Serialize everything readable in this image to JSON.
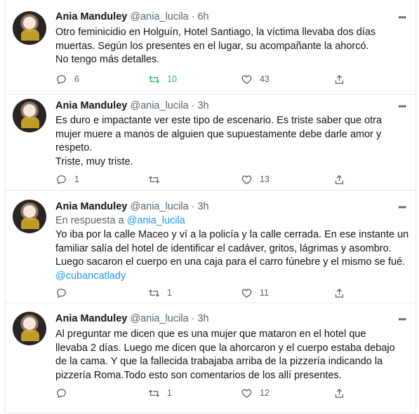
{
  "tweets": [
    {
      "name": "Ania Manduley",
      "handle": "@ania_lucila",
      "time": "· 6h",
      "reply_prefix": "",
      "reply_to": "",
      "lines": [
        "Otro feminicidio en Holguín, Hotel Santiago, la víctima llevaba dos días",
        "muertas. Según los presentes en el lugar, su acompañante la ahorcó.",
        "No tengo más detalles."
      ],
      "mention": "",
      "reply_count": "6",
      "retweet_count": "10",
      "retweet_active": true,
      "like_count": "43"
    },
    {
      "name": "Ania Manduley",
      "handle": "@ania_lucila",
      "time": "· 3h",
      "reply_prefix": "",
      "reply_to": "",
      "lines": [
        "Es duro e impactante ver este tipo de escenario. Es triste saber que otra",
        "mujer muere a manos de alguien que supuestamente debe darle amor y",
        "respeto.",
        "Triste, muy triste."
      ],
      "mention": "",
      "reply_count": "1",
      "retweet_count": "",
      "retweet_active": false,
      "like_count": "13"
    },
    {
      "name": "Ania Manduley",
      "handle": "@ania_lucila",
      "time": "· 3h",
      "reply_prefix": "En respuesta a",
      "reply_to": "@ania_lucila",
      "lines": [
        "Yo iba por la calle Maceo y ví a la policía y la calle cerrada. En ese instante un",
        "familiar salía del hotel de identificar el cadáver, gritos, lágrimas y asombro.",
        "Luego sacaron el cuerpo en una caja para el carro fúnebre y el mismo se fué."
      ],
      "mention": "@cubancatlady",
      "reply_count": "",
      "retweet_count": "1",
      "retweet_active": false,
      "like_count": "11"
    },
    {
      "name": "Ania Manduley",
      "handle": "@ania_lucila",
      "time": "· 3h",
      "reply_prefix": "",
      "reply_to": "",
      "lines": [
        "Al preguntar me dicen que es una mujer que mataron en el hotel que",
        "llevaba 2 días. Luego me dicen que la ahorcaron y el cuerpo estaba debajo",
        "de la cama. Y que la fallecida trabajaba arriba de la pizzería indicando la",
        "pizzería Roma.Todo esto son comentarios de los allí presentes."
      ],
      "mention": "",
      "reply_count": "",
      "retweet_count": "1",
      "retweet_active": false,
      "like_count": "12"
    }
  ],
  "icons": {
    "reply": "reply-icon",
    "retweet": "retweet-icon",
    "like": "heart-icon",
    "share": "share-icon",
    "more": "more-options-icon"
  },
  "colors": {
    "text": "#0f1419",
    "secondary": "#536471",
    "link": "#1d9bf0",
    "retweet_active": "#17bf63",
    "separator": "#e6ecf0"
  }
}
